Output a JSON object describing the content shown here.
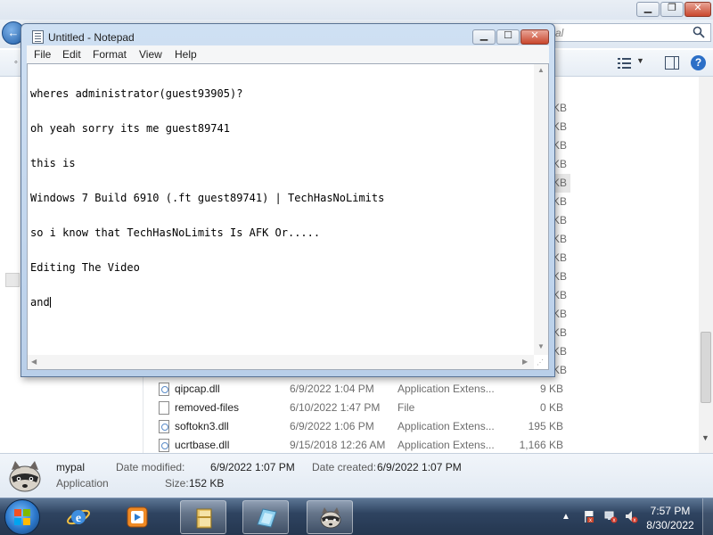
{
  "explorer": {
    "search_placeholder": "al",
    "size_fragments": [
      "KB",
      "KB",
      "KB",
      "KB",
      "KB",
      "KB",
      "KB",
      "KB",
      "KB",
      "KB",
      "KB",
      "KB",
      "KB",
      "KB",
      "KB"
    ],
    "files": [
      {
        "name": "qipcap.dll",
        "date": "6/9/2022 1:04 PM",
        "type": "Application Extens...",
        "size": "9 KB",
        "icon": "dll-file-icon"
      },
      {
        "name": "removed-files",
        "date": "6/10/2022 1:47 PM",
        "type": "File",
        "size": "0 KB",
        "icon": "generic-file-icon"
      },
      {
        "name": "softokn3.dll",
        "date": "6/9/2022 1:06 PM",
        "type": "Application Extens...",
        "size": "195 KB",
        "icon": "dll-file-icon"
      },
      {
        "name": "ucrtbase.dll",
        "date": "9/15/2018 12:26 AM",
        "type": "Application Extens...",
        "size": "1,166 KB",
        "icon": "dll-file-icon"
      }
    ],
    "details": {
      "name": "mypal",
      "kind": "Application",
      "modified_label": "Date modified:",
      "modified_value": "6/9/2022 1:07 PM",
      "size_label": "Size:",
      "size_value": "152 KB",
      "created_label": "Date created:",
      "created_value": "6/9/2022 1:07 PM"
    }
  },
  "notepad": {
    "title": "Untitled - Notepad",
    "menu": {
      "file": "File",
      "edit": "Edit",
      "format": "Format",
      "view": "View",
      "help": "Help"
    },
    "lines": [
      "wheres administrator(guest93905)?",
      "oh yeah sorry its me guest89741",
      "this is",
      "Windows 7 Build 6910 (.ft guest89741) | TechHasNoLimits",
      "so i know that TechHasNoLimits Is AFK Or.....",
      "Editing The Video",
      "and"
    ]
  },
  "taskbar": {
    "pinned": [
      "start-orb",
      "internet-explorer-icon",
      "media-player-icon",
      "explorer-folder-icon",
      "notepad-icon",
      "mypal-raccoon-icon"
    ],
    "clock_time": "7:57 PM",
    "clock_date": "8/30/2022"
  },
  "colors": {
    "titlebar_active": "#b9cfe9",
    "close_button": "#c9462c",
    "taskbar": "#2f4461",
    "link_blue": "#2c6fc7"
  }
}
